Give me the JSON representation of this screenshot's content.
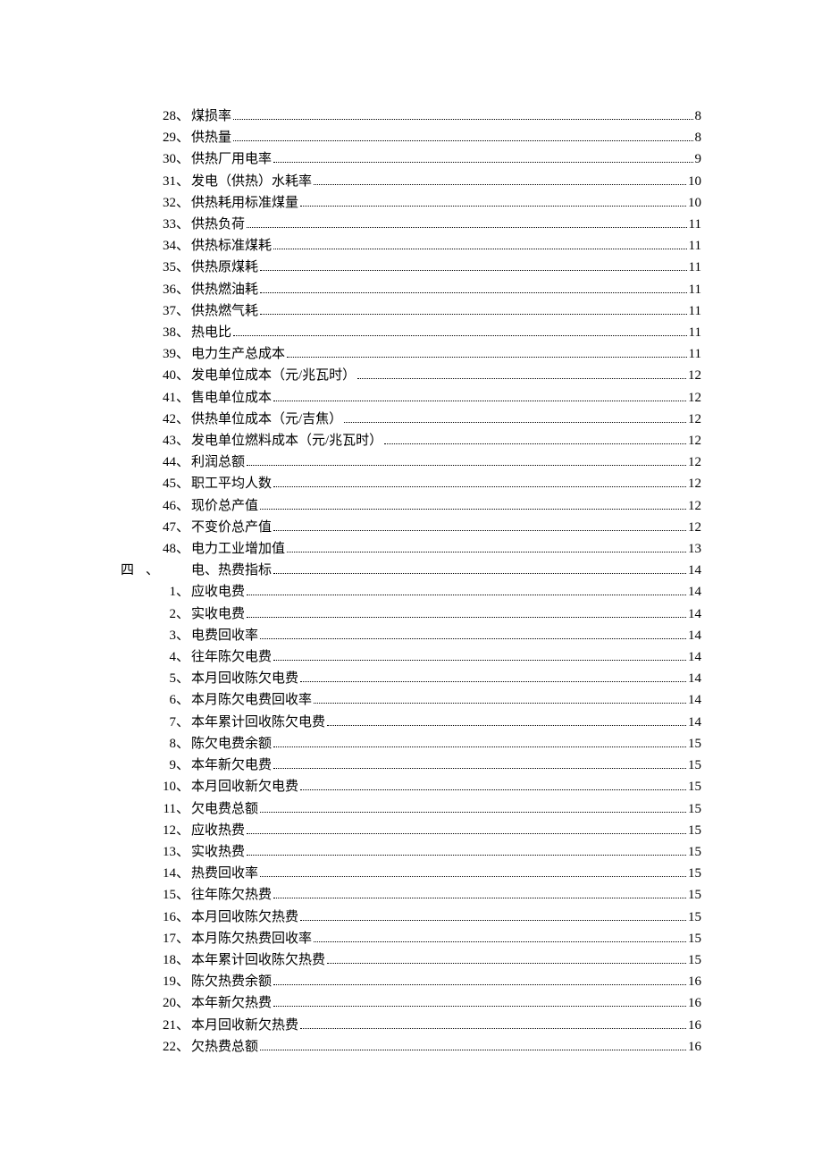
{
  "groupA": {
    "items": [
      {
        "num": "28",
        "title": "煤损率",
        "page": "8"
      },
      {
        "num": "29",
        "title": "供热量",
        "page": "8"
      },
      {
        "num": "30",
        "title": "供热厂用电率",
        "page": "9"
      },
      {
        "num": "31",
        "title": "发电（供热）水耗率",
        "page": "10"
      },
      {
        "num": "32",
        "title": "供热耗用标准煤量",
        "page": "10"
      },
      {
        "num": "33",
        "title": "供热负荷",
        "page": "11"
      },
      {
        "num": "34",
        "title": "供热标准煤耗",
        "page": "11"
      },
      {
        "num": "35",
        "title": "供热原煤耗",
        "page": "11"
      },
      {
        "num": "36",
        "title": "供热燃油耗",
        "page": "11"
      },
      {
        "num": "37",
        "title": "供热燃气耗",
        "page": "11"
      },
      {
        "num": "38",
        "title": "热电比",
        "page": "11"
      },
      {
        "num": "39",
        "title": "电力生产总成本",
        "page": "11"
      },
      {
        "num": "40",
        "title": "发电单位成本（元/兆瓦时）",
        "page": "12"
      },
      {
        "num": "41",
        "title": "售电单位成本",
        "page": "12"
      },
      {
        "num": "42",
        "title": "供热单位成本（元/吉焦）",
        "page": "12"
      },
      {
        "num": "43",
        "title": "发电单位燃料成本（元/兆瓦时）",
        "page": "12"
      },
      {
        "num": "44",
        "title": "利润总额",
        "page": "12"
      },
      {
        "num": "45",
        "title": "职工平均人数",
        "page": "12"
      },
      {
        "num": "46",
        "title": "现价总产值",
        "page": "12"
      },
      {
        "num": "47",
        "title": "不变价总产值",
        "page": "12"
      },
      {
        "num": "48",
        "title": "电力工业增加值",
        "page": "13"
      }
    ]
  },
  "section": {
    "num": "四",
    "title": "电、热费指标",
    "page": "14"
  },
  "groupB": {
    "items": [
      {
        "num": "1",
        "title": "应收电费",
        "page": "14"
      },
      {
        "num": "2",
        "title": "实收电费",
        "page": "14"
      },
      {
        "num": "3",
        "title": "电费回收率",
        "page": "14"
      },
      {
        "num": "4",
        "title": "往年陈欠电费",
        "page": "14"
      },
      {
        "num": "5",
        "title": "本月回收陈欠电费",
        "page": "14"
      },
      {
        "num": "6",
        "title": "本月陈欠电费回收率",
        "page": "14"
      },
      {
        "num": "7",
        "title": "本年累计回收陈欠电费",
        "page": "14"
      },
      {
        "num": "8",
        "title": "陈欠电费余额",
        "page": "15"
      },
      {
        "num": "9",
        "title": "本年新欠电费",
        "page": "15"
      },
      {
        "num": "10",
        "title": "本月回收新欠电费",
        "page": "15"
      },
      {
        "num": "11",
        "title": "欠电费总额",
        "page": "15"
      },
      {
        "num": "12",
        "title": "应收热费",
        "page": "15"
      },
      {
        "num": "13",
        "title": "实收热费",
        "page": "15"
      },
      {
        "num": "14",
        "title": "热费回收率",
        "page": "15"
      },
      {
        "num": "15",
        "title": "往年陈欠热费",
        "page": "15"
      },
      {
        "num": "16",
        "title": "本月回收陈欠热费",
        "page": "15"
      },
      {
        "num": "17",
        "title": "本月陈欠热费回收率",
        "page": "15"
      },
      {
        "num": "18",
        "title": "本年累计回收陈欠热费",
        "page": "15"
      },
      {
        "num": "19",
        "title": "陈欠热费余额",
        "page": "16"
      },
      {
        "num": "20",
        "title": "本年新欠热费",
        "page": "16"
      },
      {
        "num": "21",
        "title": "本月回收新欠热费",
        "page": "16"
      },
      {
        "num": "22",
        "title": "欠热费总额",
        "page": "16"
      }
    ]
  }
}
